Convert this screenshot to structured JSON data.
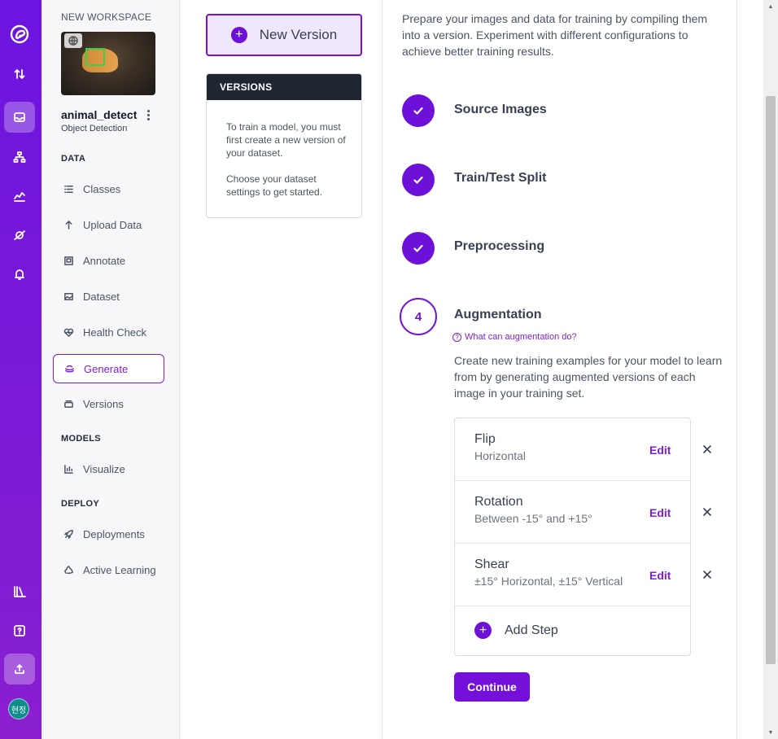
{
  "rail": {
    "items": [
      {
        "name": "logo-icon"
      },
      {
        "name": "transfer-icon"
      },
      {
        "name": "inbox-icon"
      },
      {
        "name": "hierarchy-icon"
      },
      {
        "name": "chart-icon"
      },
      {
        "name": "planet-icon"
      },
      {
        "name": "bell-icon"
      },
      {
        "name": "library-icon"
      },
      {
        "name": "help-icon"
      },
      {
        "name": "upload-icon"
      }
    ],
    "avatar_label": "현정"
  },
  "sidebar": {
    "workspace_label": "NEW WORKSPACE",
    "project_name": "animal_detect",
    "project_type": "Object Detection",
    "sections": {
      "data": "DATA",
      "models": "MODELS",
      "deploy": "DEPLOY"
    },
    "data_items": [
      {
        "label": "Classes"
      },
      {
        "label": "Upload Data"
      },
      {
        "label": "Annotate"
      },
      {
        "label": "Dataset"
      },
      {
        "label": "Health Check"
      },
      {
        "label": "Generate"
      },
      {
        "label": "Versions"
      }
    ],
    "model_items": [
      {
        "label": "Visualize"
      }
    ],
    "deploy_items": [
      {
        "label": "Deployments"
      },
      {
        "label": "Active Learning"
      }
    ],
    "active_item": "Generate"
  },
  "versions": {
    "new_button": "New Version",
    "header": "VERSIONS",
    "empty_text_1": "To train a model, you must first create a new version of your dataset.",
    "empty_text_2": "Choose your dataset settings to get started."
  },
  "main": {
    "intro": "Prepare your images and data for training by compiling them into a version. Experiment with different configurations to achieve better training results.",
    "steps": [
      {
        "title": "Source Images",
        "done": true
      },
      {
        "title": "Train/Test Split",
        "done": true
      },
      {
        "title": "Preprocessing",
        "done": true
      }
    ],
    "current_step": {
      "number": "4",
      "title": "Augmentation",
      "help_link": "What can augmentation do?",
      "description": "Create new training examples for your model to learn from by generating augmented versions of each image in your training set."
    },
    "augmentations": [
      {
        "name": "Flip",
        "detail": "Horizontal",
        "edit": "Edit"
      },
      {
        "name": "Rotation",
        "detail": "Between -15° and +15°",
        "edit": "Edit"
      },
      {
        "name": "Shear",
        "detail": "±15° Horizontal, ±15° Vertical",
        "edit": "Edit"
      }
    ],
    "add_step": "Add Step",
    "continue": "Continue"
  },
  "colors": {
    "accent": "#7310d9",
    "rail_top": "#6d14e0",
    "rail_bottom": "#8b1fd0",
    "dark_header": "#1f2631"
  }
}
